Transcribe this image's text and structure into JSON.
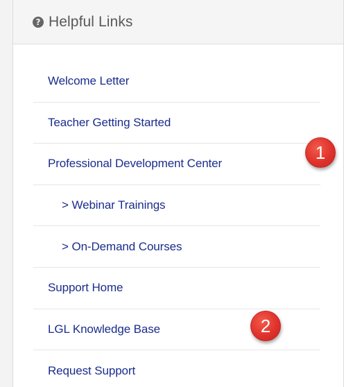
{
  "panel": {
    "title": "Helpful Links",
    "icon": "question-circle-icon",
    "links": [
      {
        "label": "Welcome Letter"
      },
      {
        "label": "Teacher Getting Started"
      },
      {
        "label": "Professional Development Center"
      },
      {
        "label": "> Webinar Trainings"
      },
      {
        "label": "> On-Demand Courses"
      },
      {
        "label": "Support Home"
      },
      {
        "label": "LGL Knowledge Base"
      },
      {
        "label": "Request Support"
      }
    ]
  },
  "annotations": {
    "badge_1": "1",
    "badge_2": "2"
  },
  "colors": {
    "link": "#1a2d8c",
    "header_bg": "#f5f5f5",
    "badge": "#e0322c"
  }
}
